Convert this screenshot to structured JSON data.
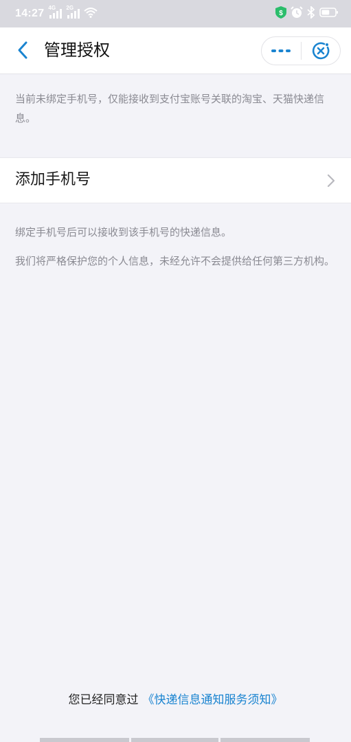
{
  "status_bar": {
    "time": "14:27",
    "signal1_label": "4G",
    "signal2_label": "2G",
    "icons": [
      "signal-icon",
      "wifi-icon",
      "shield-dollar-icon",
      "alarm-icon",
      "bluetooth-icon",
      "battery-icon"
    ],
    "battery_level": 0.6
  },
  "nav": {
    "title": "管理授权",
    "back_icon": "chevron-left-icon",
    "more_icon": "more-dots-icon",
    "close_icon": "close-circle-icon",
    "accent_color": "#1a84d0"
  },
  "notice_text": "当前未绑定手机号，仅能接收到支付宝账号关联的淘宝、天猫快递信息。",
  "add_phone": {
    "label": "添加手机号",
    "arrow_icon": "chevron-right-icon"
  },
  "info": {
    "line1": "绑定手机号后可以接收到该手机号的快递信息。",
    "line2": "我们将严格保护您的个人信息，未经允许不会提供给任何第三方机构。"
  },
  "agreement": {
    "prefix": "您已经同意过",
    "link_text": "《快递信息通知服务须知》",
    "link_color": "#1a84d0"
  }
}
